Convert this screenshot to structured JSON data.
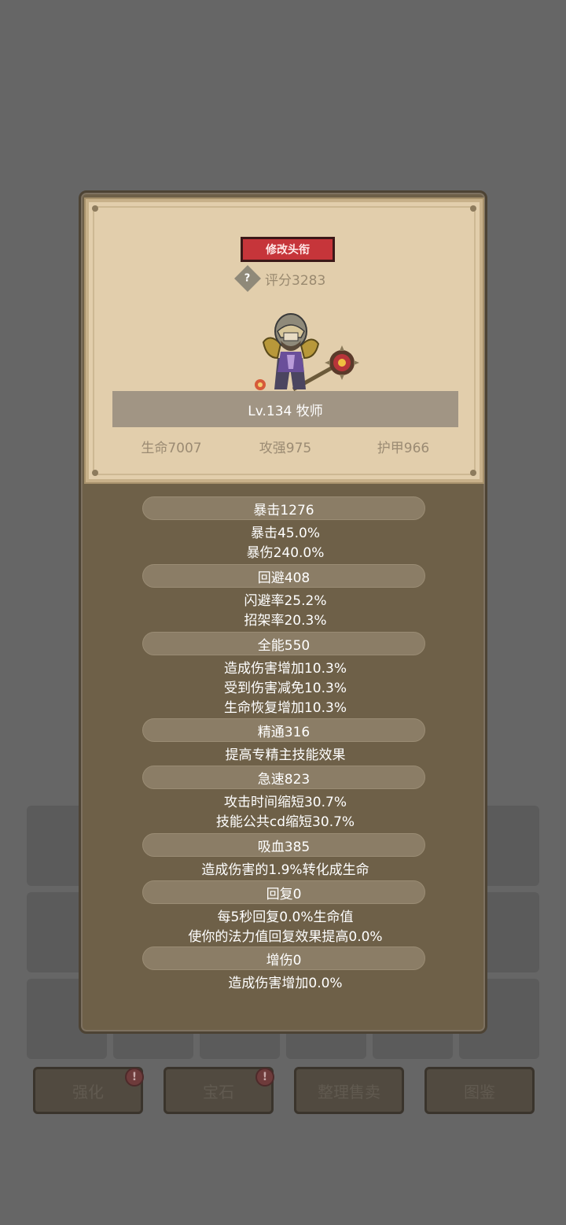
{
  "bottom_buttons": [
    {
      "label": "强化",
      "badge": "!"
    },
    {
      "label": "宝石",
      "badge": "!"
    },
    {
      "label": "整理售卖"
    },
    {
      "label": "图鉴"
    }
  ],
  "panel": {
    "rename_button": "修改头衔",
    "score_label": "评分3283",
    "help_icon": "?",
    "level_class": "Lv.134 牧师",
    "base_stats": [
      "生命7007",
      "攻强975",
      "护甲966"
    ]
  },
  "stats": [
    {
      "header": "暴击1276",
      "lines": [
        "暴击45.0%",
        "暴伤240.0%"
      ]
    },
    {
      "header": "回避408",
      "lines": [
        "闪避率25.2%",
        "招架率20.3%"
      ]
    },
    {
      "header": "全能550",
      "lines": [
        "造成伤害增加10.3%",
        "受到伤害减免10.3%",
        "生命恢复增加10.3%"
      ]
    },
    {
      "header": "精通316",
      "lines": [
        "提高专精主技能效果"
      ]
    },
    {
      "header": "急速823",
      "lines": [
        "攻击时间缩短30.7%",
        "技能公共cd缩短30.7%"
      ]
    },
    {
      "header": "吸血385",
      "lines": [
        "造成伤害的1.9%转化成生命"
      ]
    },
    {
      "header": "回复0",
      "lines": [
        "每5秒回复0.0%生命值",
        "使你的法力值回复效果提高0.0%"
      ]
    },
    {
      "header": "增伤0",
      "lines": [
        "造成伤害增加0.0%"
      ]
    }
  ],
  "colors": {
    "rename_button": "#c6353a",
    "panel_bg": "#6e6048",
    "parchment": "#e2ceac"
  }
}
